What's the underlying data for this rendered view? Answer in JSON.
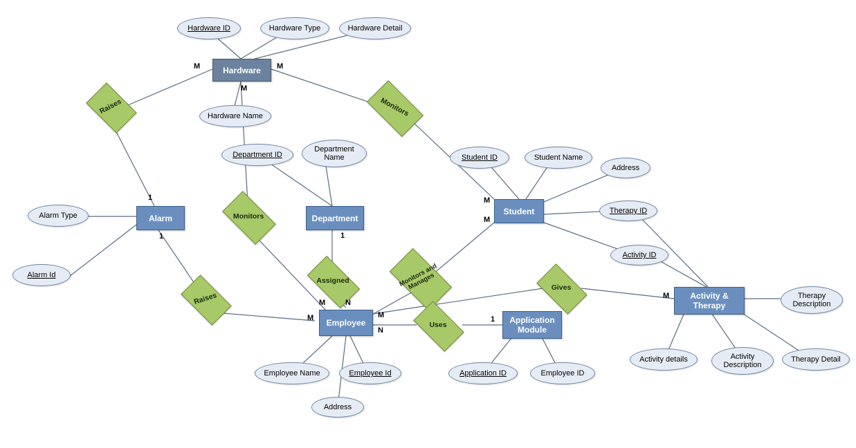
{
  "entities": {
    "hardware": "Hardware",
    "alarm": "Alarm",
    "department": "Department",
    "student": "Student",
    "employee": "Employee",
    "app_module": "Application\nModule",
    "activity_therapy": "Activity &\nTherapy"
  },
  "attributes": {
    "hardware_id": "Hardware ID",
    "hardware_type": "Hardware Type",
    "hardware_detail": "Hardware Detail",
    "hardware_name": "Hardware Name",
    "alarm_type": "Alarm Type",
    "alarm_id": "Alarm Id",
    "department_id": "Department ID",
    "department_name": "Department\nName",
    "student_id": "Student ID",
    "student_name": "Student Name",
    "student_address": "Address",
    "therapy_id": "Therapy ID",
    "activity_id": "Activity ID",
    "employee_name": "Employee Name",
    "employee_id": "Employee Id",
    "employee_address": "Address",
    "application_id": "Application ID",
    "app_employee_id": "Employee ID",
    "therapy_desc": "Therapy\nDescription",
    "activity_details": "Activity details",
    "activity_desc": "Activity\nDescription",
    "therapy_detail": "Therapy Detail"
  },
  "relationships": {
    "raises_hw": "Raises",
    "monitors_hw_student": "Monitors",
    "monitors_hw_emp": "Monitors",
    "raises_emp": "Raises",
    "assigned": "Assigned",
    "monitors_manages": "Monitors and\nManages",
    "uses": "Uses",
    "gives": "Gives"
  },
  "cardinalities": {
    "hw_raises_m": "M",
    "hw_monitors_student_m": "M",
    "hw_monitors_emp_m": "M",
    "alarm_raises_1_top": "1",
    "alarm_raises_1_bottom": "1",
    "student_monitors_m": "M",
    "student_manages_m": "M",
    "dept_assigned_1": "1",
    "emp_assigned_n": "N",
    "emp_monitors_hw_m": "M",
    "emp_raises_m": "M",
    "emp_uses_n": "N",
    "emp_manages_m": "M",
    "app_uses_1": "1",
    "activity_gives_m": "M"
  }
}
